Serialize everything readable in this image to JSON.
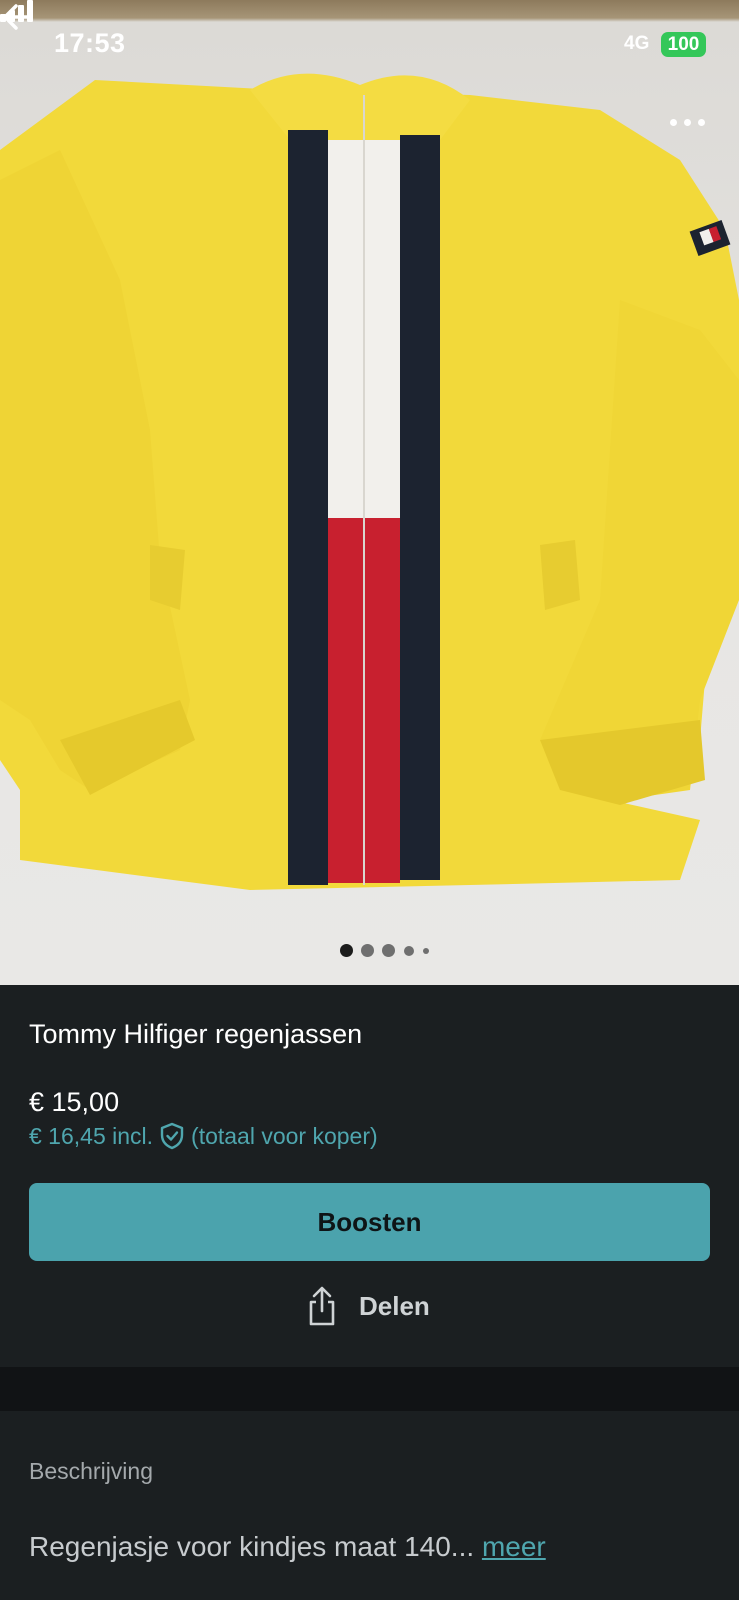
{
  "status_bar": {
    "time": "17:53",
    "network": "4G",
    "battery": "100"
  },
  "photo": {
    "description_colors": {
      "jacket": "#f2d93a",
      "navy": "#1c2330",
      "white": "#f2f0ec",
      "red": "#c8202f"
    },
    "carousel": {
      "total": 5,
      "active_index": 0
    }
  },
  "listing": {
    "title": "Tommy Hilfiger regenjassen",
    "price": "€ 15,00",
    "price_incl": "€ 16,45 incl.",
    "price_incl_note": "(totaal voor koper)",
    "boost_label": "Boosten",
    "share_label": "Delen"
  },
  "description": {
    "label": "Beschrijving",
    "text": "Regenjasje voor kindjes maat 140...",
    "more_label": "meer"
  },
  "colors": {
    "accent": "#4ba3ad",
    "accent_text": "#4fa6ae",
    "background": "#1b1f21"
  }
}
